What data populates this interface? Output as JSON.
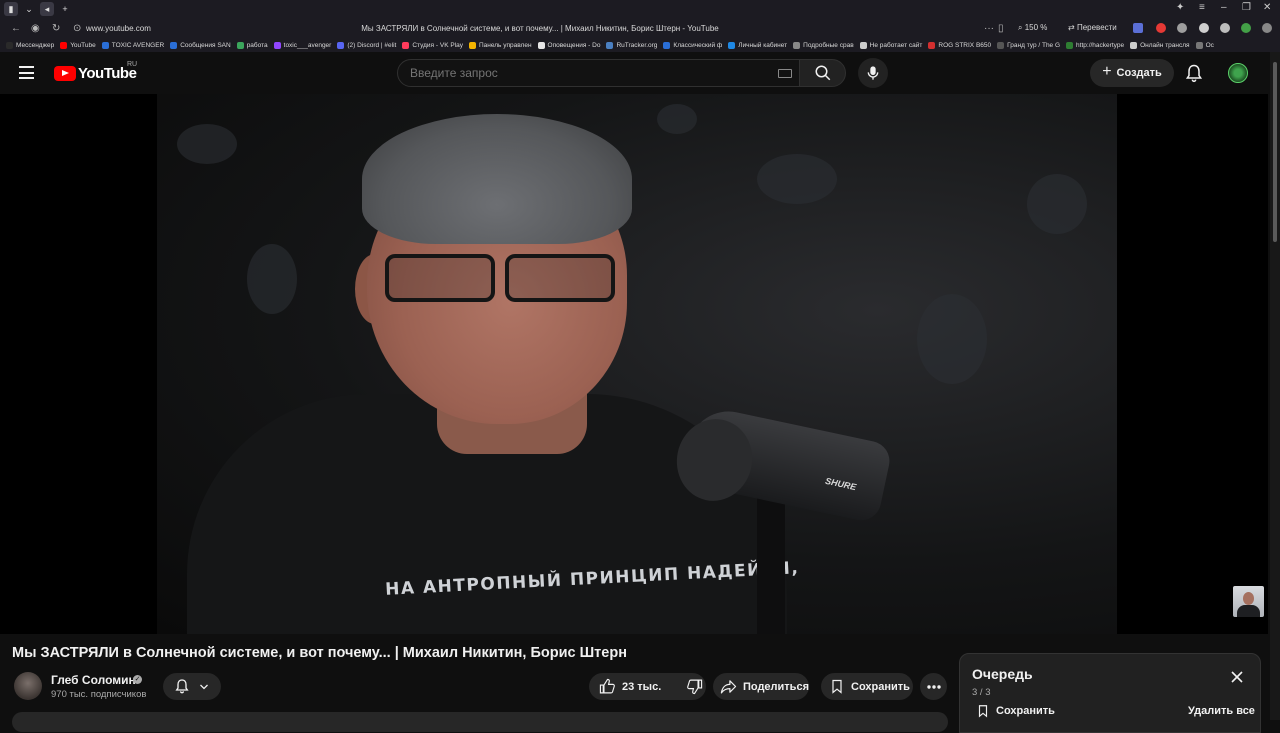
{
  "browser": {
    "url": "www.youtube.com",
    "tab_title": "Мы ЗАСТРЯЛИ в Солнечной системе, и вот почему... | Михаил Никитин, Борис Штерн - YouTube",
    "zoom": "150 %",
    "translate_label": "Перевести"
  },
  "bookmarks": [
    {
      "label": "Мессенджер",
      "color": "#2a2a2a"
    },
    {
      "label": "YouTube",
      "color": "#ff0000"
    },
    {
      "label": "TOXIC AVENGER",
      "color": "#2a6ed6"
    },
    {
      "label": "Сообщения SAN",
      "color": "#2a6ed6"
    },
    {
      "label": "работа",
      "color": "#3ba55c"
    },
    {
      "label": "toxic___avenger",
      "color": "#9146ff"
    },
    {
      "label": "(2) Discord | #elit",
      "color": "#5865f2"
    },
    {
      "label": "Студия - VK Play",
      "color": "#ff3b5c"
    },
    {
      "label": "Панель управлен",
      "color": "#f4b400"
    },
    {
      "label": "Оповещения - Do",
      "color": "#e6e6e6"
    },
    {
      "label": "RuTracker.org",
      "color": "#4a7fc1"
    },
    {
      "label": "Классический ф",
      "color": "#2a6ed6"
    },
    {
      "label": "Личный кабинет",
      "color": "#1e88e5"
    },
    {
      "label": "Подробные срав",
      "color": "#888888"
    },
    {
      "label": "Не работает сайт",
      "color": "#cccccc"
    },
    {
      "label": "ROG STRIX B650",
      "color": "#d32f2f"
    },
    {
      "label": "Гранд тур / The G",
      "color": "#555555"
    },
    {
      "label": "http://hackertype",
      "color": "#2e7d32"
    },
    {
      "label": "Онлайн трансля",
      "color": "#cccccc"
    },
    {
      "label": "Ос",
      "color": "#777777"
    }
  ],
  "header": {
    "logo_text": "YouTube",
    "region": "RU",
    "search_placeholder": "Введите запрос",
    "create_label": "Создать"
  },
  "video": {
    "shirt_text": "НА АНТРОПНЫЙ ПРИНЦИП НАДЕЙСЯ,",
    "mic_brand": "SHURE",
    "title": "Мы ЗАСТРЯЛИ в Солнечной системе, и вот почему... | Михаил Никитин, Борис Штерн"
  },
  "channel": {
    "name": "Глеб Соломин",
    "subscribers": "970 тыс. подписчиков"
  },
  "actions": {
    "likes": "23 тыс.",
    "share": "Поделиться",
    "save": "Сохранить"
  },
  "queue": {
    "title": "Очередь",
    "count": "3 / 3",
    "save": "Сохранить",
    "delete_all": "Удалить все"
  },
  "colors": {
    "background": "#0f0f0f",
    "brand_red": "#ff0000",
    "pill": "#272727",
    "secondary_text": "#aaaaaa"
  }
}
